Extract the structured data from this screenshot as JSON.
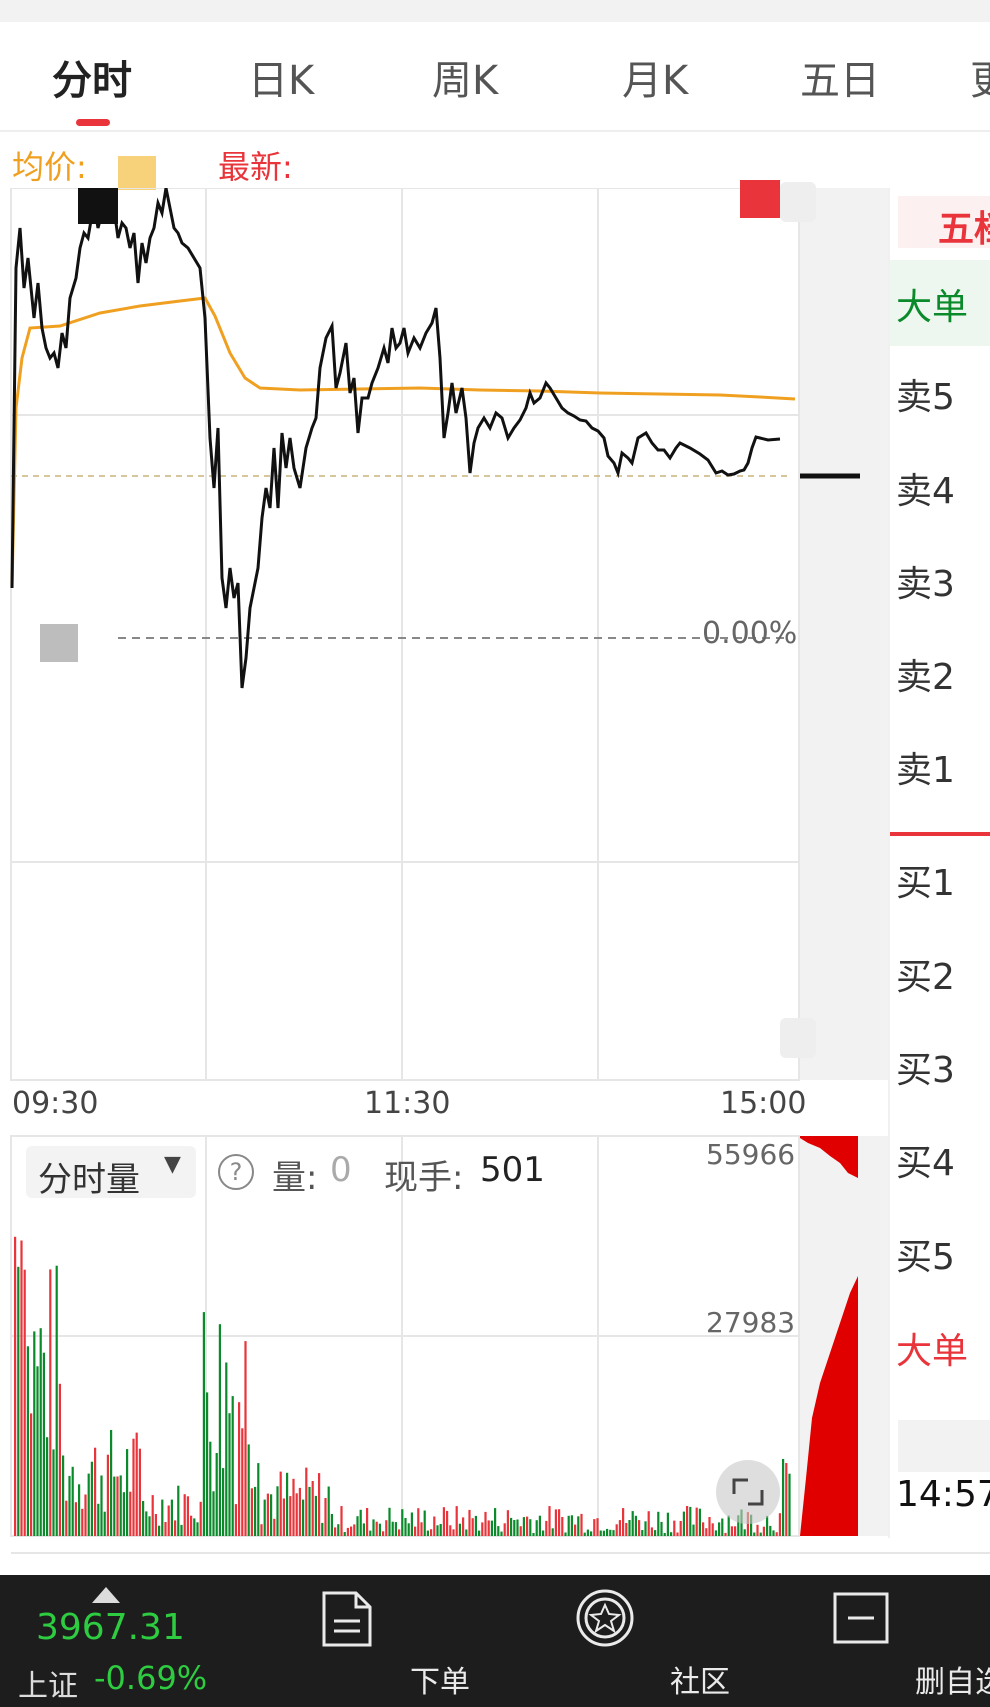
{
  "tabs": [
    {
      "label": "分时",
      "active": true
    },
    {
      "label": "日K"
    },
    {
      "label": "周K"
    },
    {
      "label": "月K"
    },
    {
      "label": "五日"
    },
    {
      "label": "更"
    }
  ],
  "info": {
    "avg_label": "均价:",
    "latest_label": "最新:"
  },
  "chart": {
    "time_labels": [
      "09:30",
      "11:30",
      "15:00"
    ],
    "zero_label": "0.00%",
    "volume_selector": "分时量",
    "volume_label": "量:",
    "volume_value": "0",
    "current_label": "现手:",
    "current_value": "501",
    "vol_max": "55966",
    "vol_mid": "27983"
  },
  "orderbook": {
    "title": "五档",
    "big_top": "大单",
    "sells": [
      "卖5",
      "卖4",
      "卖3",
      "卖2",
      "卖1"
    ],
    "buys": [
      "买1",
      "买2",
      "买3",
      "买4",
      "买5"
    ],
    "big_bottom": "大单",
    "time": "14:57"
  },
  "bottom_nav": {
    "index_value": "3967.31",
    "index_name": "上证",
    "index_change": "-0.69%",
    "items": [
      "下单",
      "社区",
      "删自选"
    ]
  },
  "colors": {
    "up": "#e8343a",
    "down": "#0a8a2a",
    "avg_line": "#f0a020",
    "price_line": "#111111"
  },
  "icons": [
    "dropdown-triangle-icon",
    "help-circle-icon",
    "order-document-icon",
    "community-star-icon",
    "remove-watch-icon",
    "expand-icon",
    "arrow-up-icon"
  ]
}
